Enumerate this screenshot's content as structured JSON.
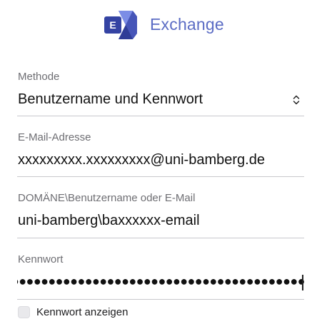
{
  "header": {
    "logo_icon": "exchange-logo-icon",
    "logo_letter": "E",
    "brand_name": "Exchange",
    "brand_color": "#5b6cc4"
  },
  "form": {
    "method": {
      "label": "Methode",
      "value": "Benutzername und Kennwort",
      "icon": "chevron-up-down-icon"
    },
    "email": {
      "label": "E-Mail-Adresse",
      "value": "xxxxxxxxx.xxxxxxxxx@uni-bamberg.de"
    },
    "username": {
      "label": "DOMÄNE\\Benutzername oder E-Mail",
      "value": "uni-bamberg\\baxxxxxx-email"
    },
    "password": {
      "label": "Kennwort",
      "masked_value": "●●●●●●●●●●●●●●●●●●●●●●●●●●●●●●●●●●●●●●●●●●●●●●"
    },
    "show_password": {
      "label": "Kennwort anzeigen",
      "checked": false
    }
  }
}
